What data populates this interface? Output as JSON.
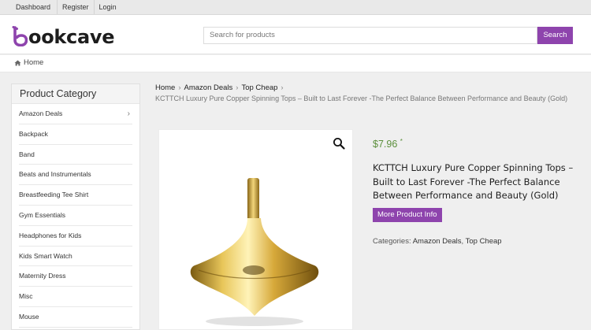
{
  "topbar": {
    "links": [
      "Dashboard",
      "Register",
      "Login"
    ]
  },
  "header": {
    "logo_text": "ookcave",
    "search_placeholder": "Search for products",
    "search_button": "Search",
    "brand_color": "#8e44ad"
  },
  "homerow": {
    "home_label": "Home"
  },
  "sidebar": {
    "title": "Product Category",
    "items": [
      "Amazon Deals",
      "Backpack",
      "Band",
      "Beats and Instrumentals",
      "Breastfeeding Tee Shirt",
      "Gym Essentials",
      "Headphones for Kids",
      "Kids Smart Watch",
      "Maternity Dress",
      "Misc",
      "Mouse"
    ]
  },
  "breadcrumb": {
    "items": [
      "Home",
      "Amazon Deals",
      "Top Cheap"
    ],
    "current": "KCTTCH Luxury Pure Copper Spinning Tops – Built to Last Forever -The Perfect Balance Between Performance and Beauty (Gold)"
  },
  "product": {
    "price": "$7.96",
    "price_mark": "*",
    "title": "KCTTCH Luxury Pure Copper Spinning Tops – Built to Last Forever -The Perfect Balance Between Performance and Beauty (Gold)",
    "more_button": "More Product Info",
    "categories_label": "Categories:",
    "categories": [
      "Amazon Deals",
      "Top Cheap"
    ],
    "categories_sep": ","
  }
}
